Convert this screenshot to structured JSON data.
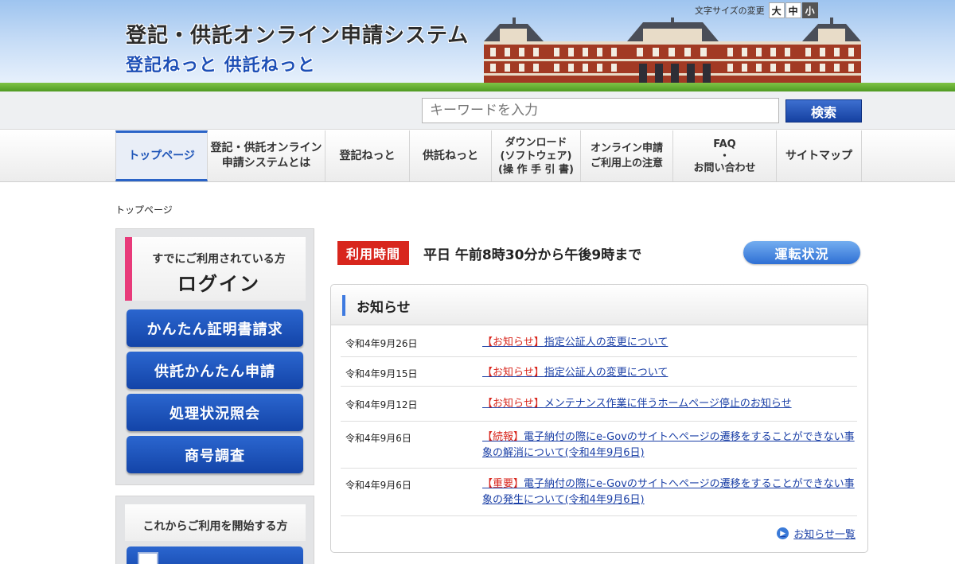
{
  "header": {
    "title": "登記・供託オンライン申請システム",
    "subtitle": "登記ねっと 供託ねっと",
    "font_size_label": "文字サイズの変更",
    "font_sizes": [
      "大",
      "中",
      "小"
    ]
  },
  "search": {
    "placeholder": "キーワードを入力",
    "button_label": "検索"
  },
  "nav": {
    "items": [
      "トップページ",
      "登記・供託オンライン\n申請システムとは",
      "登記ねっと",
      "供託ねっと",
      "ダウンロード\n(ソフトウェア)\n(操 作 手 引 書)",
      "オンライン申請\nご利用上の注意",
      "FAQ\n・\nお問い合わせ",
      "サイトマップ"
    ]
  },
  "breadcrumb": "トップページ",
  "sidebar": {
    "login_subtitle": "すでにご利用されている方",
    "login_title": "ログイン",
    "buttons": [
      "かんたん証明書請求",
      "供託かんたん申請",
      "処理状況照会",
      "商号調査"
    ],
    "start_title": "これからご利用を開始する方"
  },
  "hours": {
    "badge": "利用時間",
    "text": "平日 午前8時30分から午後9時まで",
    "status_button": "運転状況"
  },
  "news": {
    "title": "お知らせ",
    "items": [
      {
        "date": "令和4年9月26日",
        "tag": "【お知らせ】",
        "text": "指定公証人の変更について"
      },
      {
        "date": "令和4年9月15日",
        "tag": "【お知らせ】",
        "text": "指定公証人の変更について"
      },
      {
        "date": "令和4年9月12日",
        "tag": "【お知らせ】",
        "text": "メンテナンス作業に伴うホームページ停止のお知らせ"
      },
      {
        "date": "令和4年9月6日",
        "tag": "【続報】",
        "text": "電子納付の際にe-Govのサイトへページの遷移をすることができない事象の解消について(令和4年9月6日)"
      },
      {
        "date": "令和4年9月6日",
        "tag": "【重要】",
        "text": "電子納付の際にe-Govのサイトへページの遷移をすることができない事象の発生について(令和4年9月6日)"
      }
    ],
    "more_label": "お知らせ一覧"
  },
  "colors": {
    "accent_blue": "#1f55b8",
    "badge_red": "#d8261d",
    "login_pink": "#e83a7a"
  }
}
